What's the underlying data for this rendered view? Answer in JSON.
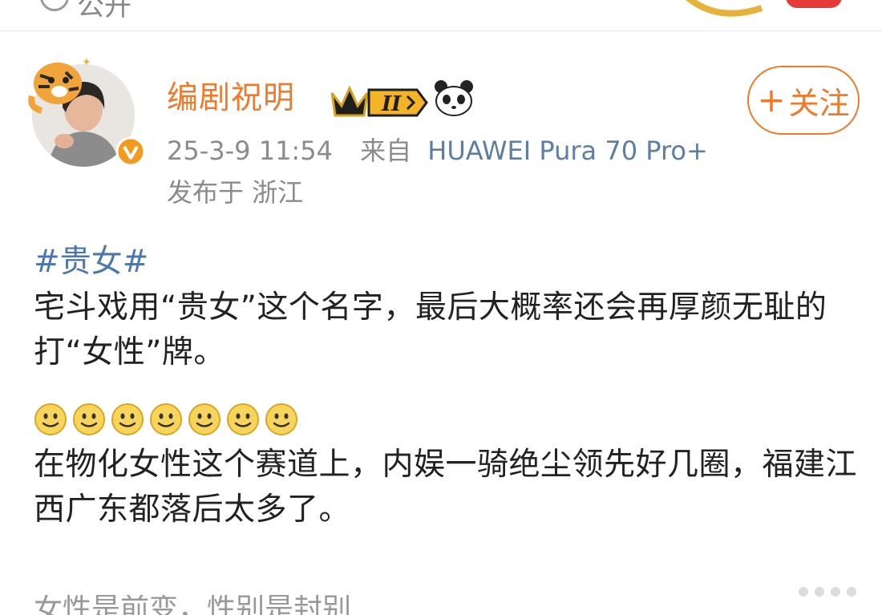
{
  "topbar": {
    "publish_label": "公开"
  },
  "post": {
    "author": "编剧祝明",
    "follow_label": "关注",
    "timestamp": "25-3-9 11:54",
    "source_prefix": "来自",
    "device": "HUAWEI Pura 70 Pro+",
    "location": "发布于 浙江",
    "topic": "#贵女#",
    "paragraph1": "宅斗戏用“贵女”这个名字，最后大概率还会再厚颜无耻的打“女性”牌。",
    "emoji_count": 7,
    "paragraph2": "在物化女性这个赛道上，内娱一骑绝尘领先好几圈，福建江西广东都落后太多了。",
    "bottom_partial": "女性是前变，性别是封别"
  },
  "colors": {
    "brand_orange": "#f07a28",
    "link_blue": "#4b77b0",
    "meta_gray": "#8b8b8b"
  },
  "icons": [
    "public-icon",
    "tiger-decoration-icon",
    "verified-icon",
    "crown-level-badge-icon",
    "panda-badge-icon",
    "smile-emoji-icon",
    "more-dots-icon"
  ]
}
